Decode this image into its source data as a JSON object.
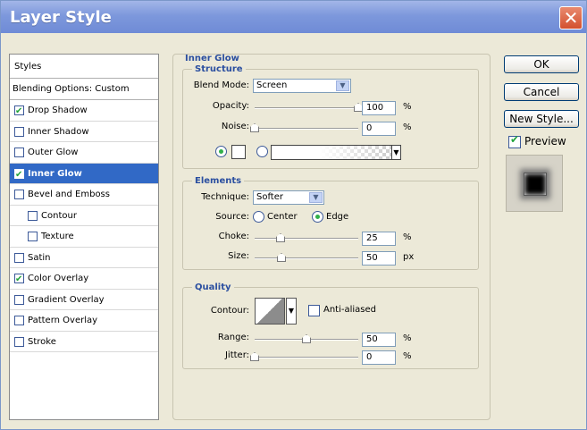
{
  "window": {
    "title": "Layer Style",
    "close_glyph": "✕"
  },
  "styles_list": {
    "header": "Styles",
    "blending_options": "Blending Options: Custom",
    "items": [
      {
        "label": "Drop Shadow",
        "checked": true,
        "active": false,
        "sub": false
      },
      {
        "label": "Inner Shadow",
        "checked": false,
        "active": false,
        "sub": false
      },
      {
        "label": "Outer Glow",
        "checked": false,
        "active": false,
        "sub": false
      },
      {
        "label": "Inner Glow",
        "checked": true,
        "active": true,
        "sub": false
      },
      {
        "label": "Bevel and Emboss",
        "checked": false,
        "active": false,
        "sub": false
      },
      {
        "label": "Contour",
        "checked": false,
        "active": false,
        "sub": true
      },
      {
        "label": "Texture",
        "checked": false,
        "active": false,
        "sub": true
      },
      {
        "label": "Satin",
        "checked": false,
        "active": false,
        "sub": false
      },
      {
        "label": "Color Overlay",
        "checked": true,
        "active": false,
        "sub": false
      },
      {
        "label": "Gradient Overlay",
        "checked": false,
        "active": false,
        "sub": false
      },
      {
        "label": "Pattern Overlay",
        "checked": false,
        "active": false,
        "sub": false
      },
      {
        "label": "Stroke",
        "checked": false,
        "active": false,
        "sub": false
      }
    ]
  },
  "panel": {
    "title": "Inner Glow",
    "structure": {
      "title": "Structure",
      "blend_mode_label": "Blend Mode:",
      "blend_mode_value": "Screen",
      "opacity_label": "Opacity:",
      "opacity_value": "100",
      "opacity_unit": "%",
      "opacity_level": 1.0,
      "noise_label": "Noise:",
      "noise_value": "0",
      "noise_unit": "%",
      "noise_level": 0.0
    },
    "elements": {
      "title": "Elements",
      "technique_label": "Technique:",
      "technique_value": "Softer",
      "source_label": "Source:",
      "source_center": "Center",
      "source_edge": "Edge",
      "choke_label": "Choke:",
      "choke_value": "25",
      "choke_unit": "%",
      "choke_level": 0.25,
      "size_label": "Size:",
      "size_value": "50",
      "size_unit": "px"
    },
    "quality": {
      "title": "Quality",
      "contour_label": "Contour:",
      "anti_aliased_label": "Anti-aliased",
      "range_label": "Range:",
      "range_value": "50",
      "range_unit": "%",
      "range_level": 0.5,
      "jitter_label": "Jitter:",
      "jitter_value": "0",
      "jitter_unit": "%",
      "jitter_level": 0.0
    }
  },
  "buttons": {
    "ok": "OK",
    "cancel": "Cancel",
    "new_style": "New Style...",
    "preview_label": "Preview"
  },
  "colors": {
    "accent": "#3169c6",
    "title_bar": "#7d98dc",
    "section_title": "#2b4fa0"
  }
}
